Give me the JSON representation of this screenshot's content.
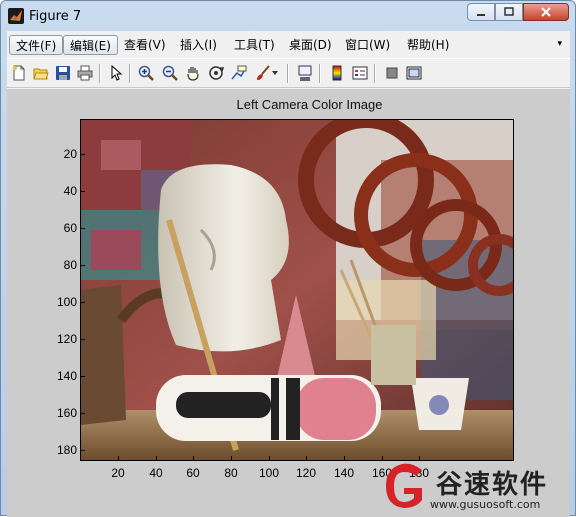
{
  "window": {
    "title": "Figure 7",
    "minimize_icon": "minimize-icon",
    "maximize_icon": "maximize-icon",
    "close_icon": "close-icon"
  },
  "menu": {
    "items": [
      {
        "label": "文件(F)",
        "active": true
      },
      {
        "label": "编辑(E)",
        "active": true
      },
      {
        "label": "查看(V)",
        "active": false
      },
      {
        "label": "插入(I)",
        "active": false
      },
      {
        "label": "工具(T)",
        "active": false
      },
      {
        "label": "桌面(D)",
        "active": false
      },
      {
        "label": "窗口(W)",
        "active": false
      },
      {
        "label": "帮助(H)",
        "active": false
      }
    ],
    "overflow_icon": "menu-arrow-icon"
  },
  "toolbar": {
    "icons": [
      "new-figure-icon",
      "open-file-icon",
      "save-icon",
      "print-icon",
      "select-arrow-icon",
      "zoom-in-icon",
      "zoom-out-icon",
      "pan-hand-icon",
      "rotate-3d-icon",
      "data-cursor-icon",
      "brush-icon",
      "brush-dropdown-icon",
      "link-plot-icon",
      "colorbar-icon",
      "legend-icon",
      "hide-plot-tools-icon",
      "show-plot-tools-icon"
    ]
  },
  "plot": {
    "title": "Left Camera Color Image",
    "yticks": [
      "20",
      "40",
      "60",
      "80",
      "100",
      "120",
      "140",
      "160",
      "180"
    ],
    "xticks": [
      "20",
      "40",
      "60",
      "80",
      "100",
      "120",
      "140",
      "160",
      "180"
    ]
  },
  "watermark": {
    "text": "谷速软件",
    "url": "www.gusuosoft.com"
  },
  "colors": {
    "figure_bg": "#cccccc",
    "window_frame": "#b7cde6",
    "close_button": "#c7432f"
  }
}
